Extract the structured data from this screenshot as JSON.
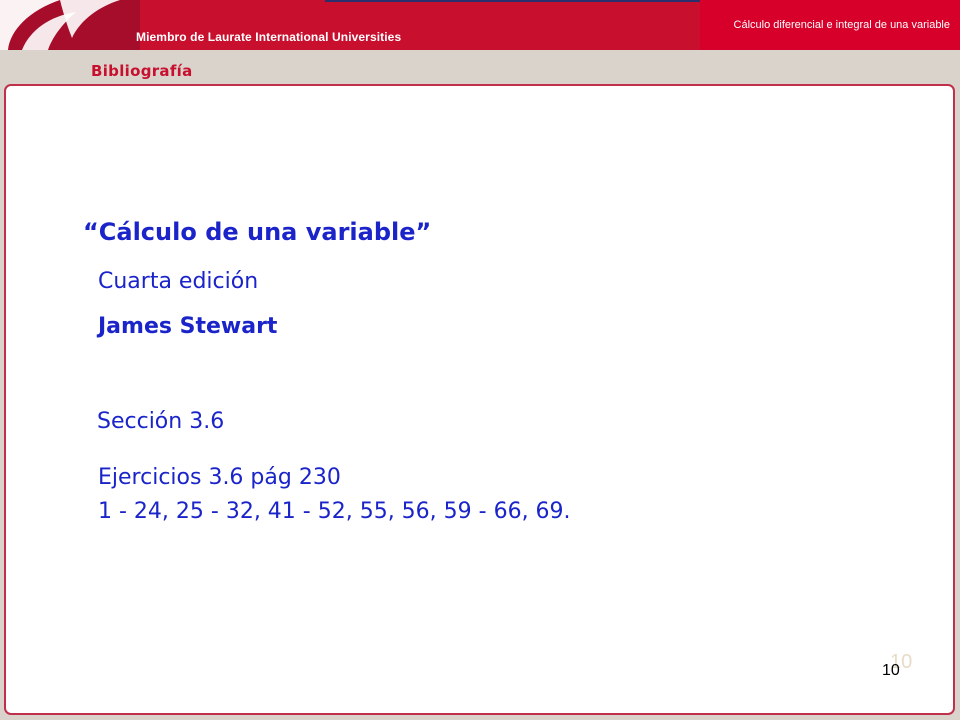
{
  "header": {
    "affiliation": "Miembro de Laurate International Universities",
    "course_title": "Cálculo diferencial e integral de una variable"
  },
  "slide": {
    "section_label": "Bibliografía",
    "book_title": "“Cálculo de una variable”",
    "edition": "Cuarta edición",
    "author": "James Stewart",
    "section": "Sección 3.6",
    "exercises_title": "Ejercicios 3.6 pág 230",
    "exercises_list": "1 - 24, 25 - 32, 41 - 52, 55, 56, 59 - 66, 69.",
    "page_number": "10",
    "page_number_ghost": "10"
  },
  "colors": {
    "brand_red": "#c8102e",
    "text_blue": "#1a24c9",
    "background": "#d9d3cc"
  },
  "icons": {
    "logo": "university-logo-icon"
  }
}
